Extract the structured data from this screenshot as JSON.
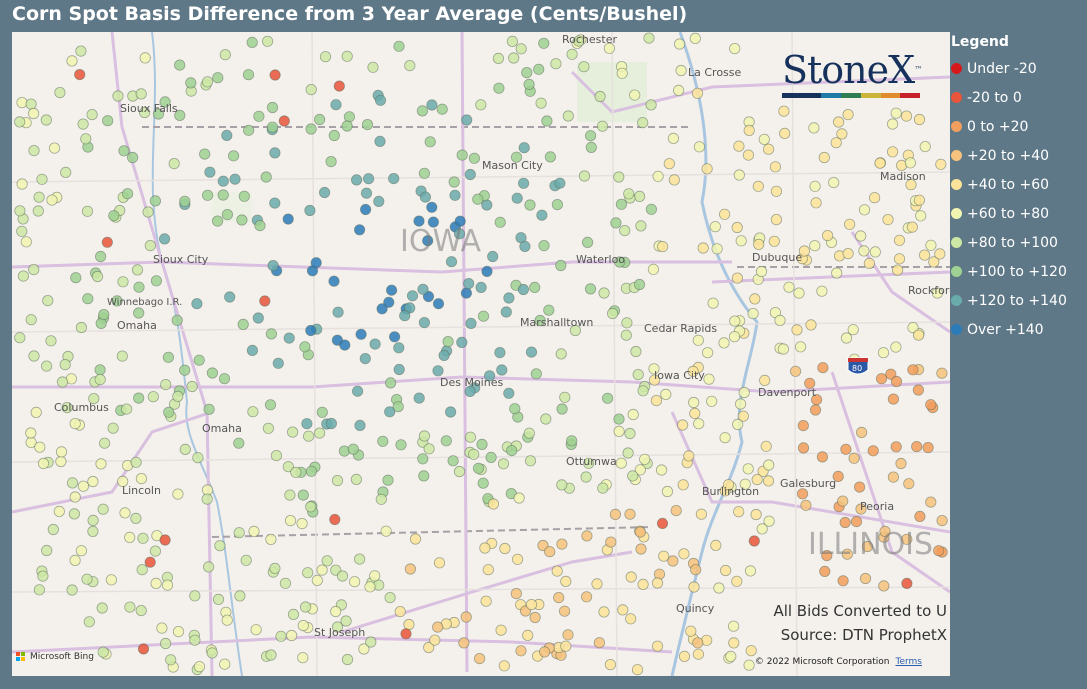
{
  "title": "Corn Spot Basis Difference from 3 Year Average (Cents/Bushel)",
  "legend": {
    "title": "Legend",
    "items": [
      {
        "label": "Under -20",
        "color": "#d7191c"
      },
      {
        "label": "-20 to 0",
        "color": "#e8553b"
      },
      {
        "label": "0 to +20",
        "color": "#f29e5c"
      },
      {
        "label": "+20 to +40",
        "color": "#f6c27d"
      },
      {
        "label": "+40 to +60",
        "color": "#fbe49a"
      },
      {
        "label": "+60 to +80",
        "color": "#f1f5b2"
      },
      {
        "label": "+80 to +100",
        "color": "#cde8a4"
      },
      {
        "label": "+100 to +120",
        "color": "#9fd192"
      },
      {
        "label": "+120 to +140",
        "color": "#6aacab"
      },
      {
        "label": "Over +140",
        "color": "#2b7bb9"
      }
    ]
  },
  "logo": {
    "text": "StoneX",
    "tm": "™"
  },
  "map": {
    "state_label": "IOWA",
    "state_label_2": "ILLINOIS",
    "cities": [
      "Rochester",
      "La Crosse",
      "Sioux Falls",
      "Mason City",
      "Madison",
      "Sioux City",
      "Waterloo",
      "Dubuque",
      "Rockford",
      "Winnebago I.R.",
      "Omaha",
      "Marshalltown",
      "Cedar Rapids",
      "Des Moines",
      "Iowa City",
      "Davenport",
      "Columbus",
      "Omaha",
      "Ottumwa",
      "Lincoln",
      "Galesburg",
      "Burlington",
      "Peoria",
      "Quincy",
      "St Joseph"
    ],
    "highway_shield": "80"
  },
  "notes": {
    "line1": "All Bids Converted to U",
    "line2": "Source: DTN ProphetX"
  },
  "attribution": {
    "bing": "Microsoft Bing",
    "copyright": "© 2022 Microsoft Corporation",
    "terms": "Terms"
  }
}
